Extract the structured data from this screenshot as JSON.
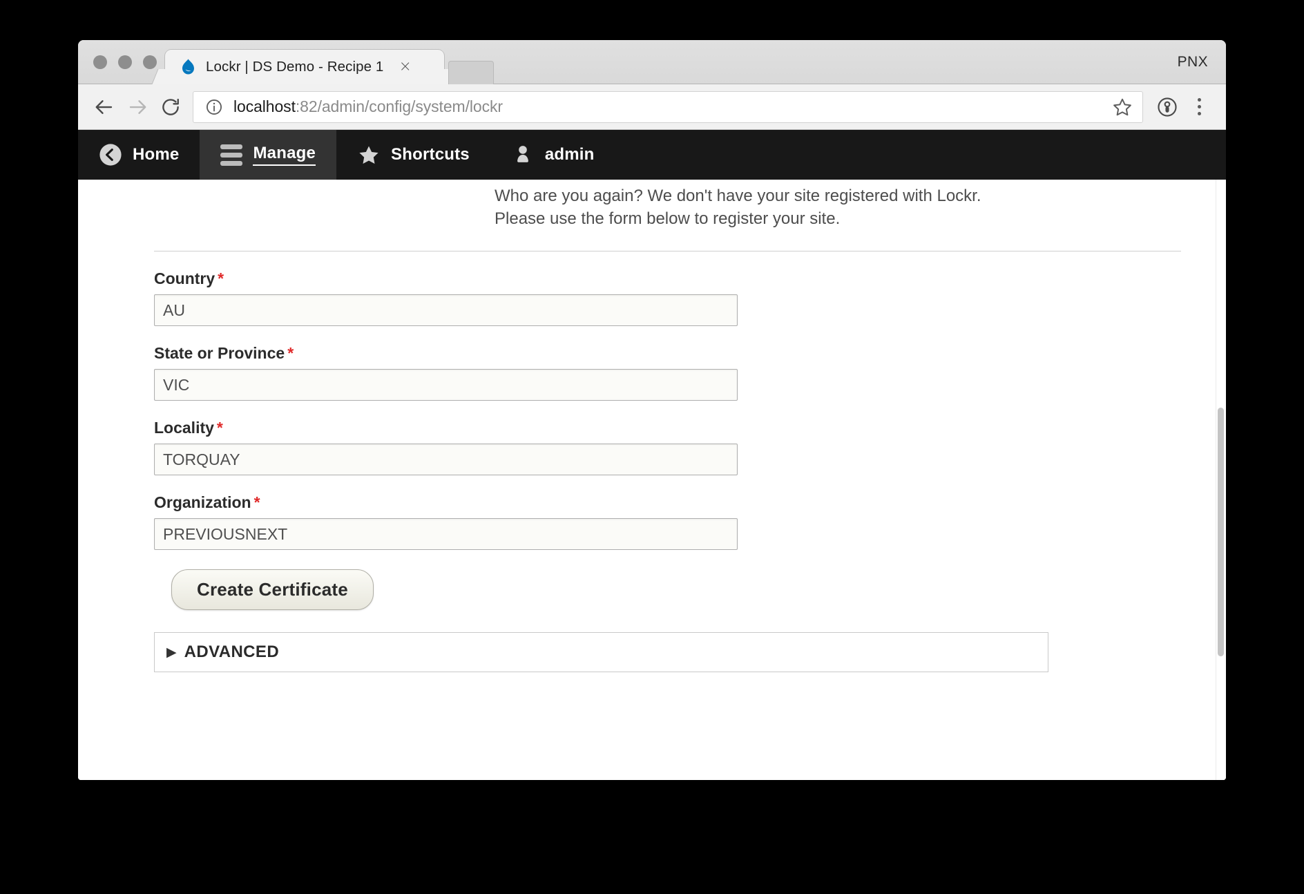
{
  "browser": {
    "tab": {
      "title": "Lockr | DS Demo - Recipe 1",
      "favicon": "drupal-droplet-icon",
      "close_label": "×"
    },
    "profile_label": "PNX",
    "address": {
      "host": "localhost",
      "path": ":82/admin/config/system/lockr",
      "full_url": "localhost:82/admin/config/system/lockr",
      "security_icon": "info-circle-icon"
    },
    "nav": {
      "back": "back-arrow-icon",
      "forward": "forward-arrow-icon",
      "reload": "reload-icon"
    },
    "actions": {
      "bookmark": "star-icon",
      "profile": "person-circle-icon",
      "menu": "three-dot-menu-icon"
    }
  },
  "admin_toolbar": {
    "items": [
      {
        "label": "Home",
        "icon": "back-circle-icon",
        "active": false
      },
      {
        "label": "Manage",
        "icon": "hamburger-icon",
        "active": true
      },
      {
        "label": "Shortcuts",
        "icon": "star-icon",
        "active": false
      },
      {
        "label": "admin",
        "icon": "person-icon",
        "active": false
      }
    ]
  },
  "page": {
    "status_message": "Who are you again? We don't have your site registered with Lockr. Please use the form below to register your site.",
    "form": {
      "fields": [
        {
          "label": "Country",
          "required": "*",
          "value": "AU"
        },
        {
          "label": "State or Province",
          "required": "*",
          "value": "VIC"
        },
        {
          "label": "Locality",
          "required": "*",
          "value": "TORQUAY"
        },
        {
          "label": "Organization",
          "required": "*",
          "value": "PREVIOUSNEXT"
        }
      ],
      "submit_label": "Create Certificate"
    },
    "advanced": {
      "label": "ADVANCED",
      "triangle": "▶"
    }
  },
  "colors": {
    "required_asterisk": "#e02a2a",
    "admin_toolbar_bg": "#181818",
    "admin_toolbar_active_bg": "#333333",
    "favicon_blue": "#0678be"
  }
}
